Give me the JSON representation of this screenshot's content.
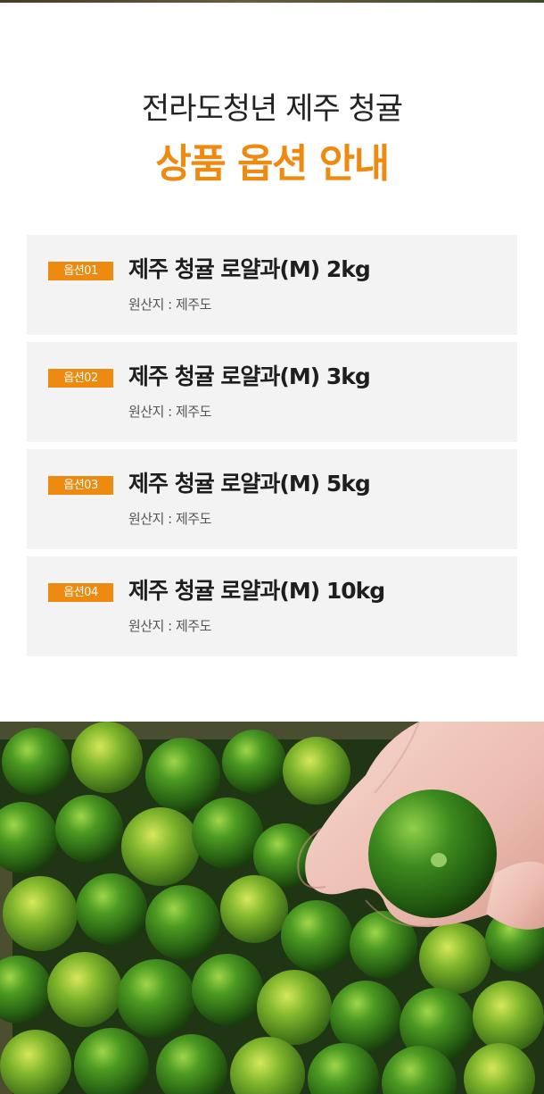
{
  "header": {
    "headline": "전라도청년 제주 청귤",
    "subheadline": "상품 옵션 안내"
  },
  "options": [
    {
      "badge": "옵션01",
      "name": "제주 청귤 로얄과(M) 2kg",
      "origin": "원산지 : 제주도"
    },
    {
      "badge": "옵션02",
      "name": "제주 청귤 로얄과(M) 3kg",
      "origin": "원산지 : 제주도"
    },
    {
      "badge": "옵션03",
      "name": "제주 청귤 로얄과(M) 5kg",
      "origin": "원산지 : 제주도"
    },
    {
      "badge": "옵션04",
      "name": "제주 청귤 로얄과(M) 10kg",
      "origin": "원산지 : 제주도"
    }
  ],
  "colors": {
    "accent": "#ef8a10",
    "card_background": "#f3f3f3",
    "text_dark": "#1e1e1e"
  }
}
